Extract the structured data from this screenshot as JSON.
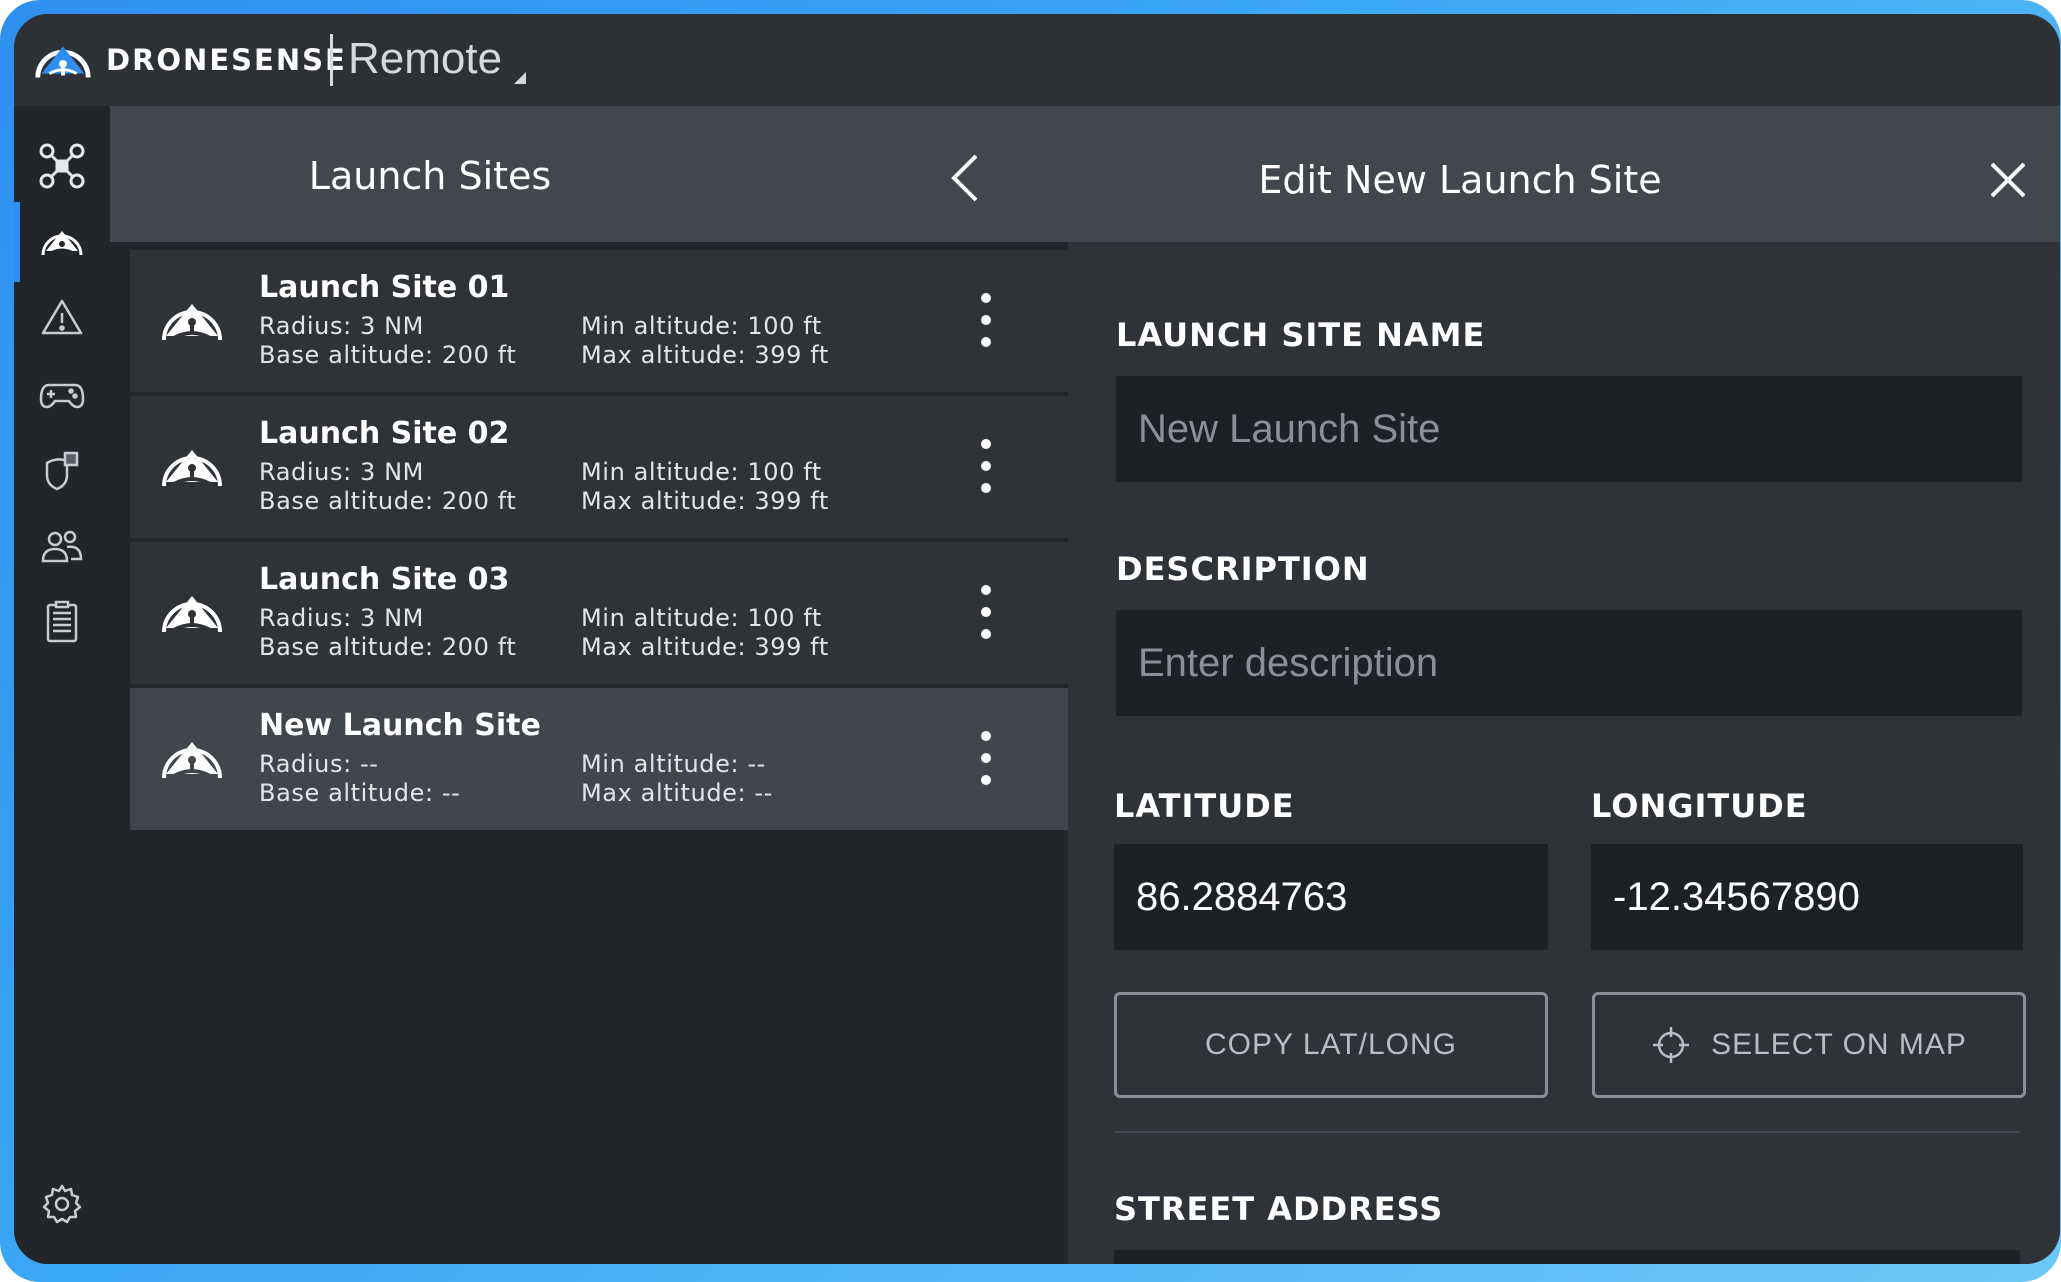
{
  "app": {
    "brand": "DRONESENSE",
    "app_name": "Remote"
  },
  "rail": {
    "items": [
      {
        "icon": "drone-icon",
        "active": false
      },
      {
        "icon": "launch-site-icon",
        "active": true
      },
      {
        "icon": "alert-icon",
        "active": false
      },
      {
        "icon": "gamepad-icon",
        "active": false
      },
      {
        "icon": "shield-badge-icon",
        "active": false
      },
      {
        "icon": "users-icon",
        "active": false
      },
      {
        "icon": "document-icon",
        "active": false
      },
      {
        "icon": "gear-icon",
        "active": false
      }
    ]
  },
  "list": {
    "title": "Launch Sites",
    "sites": [
      {
        "name": "Launch Site 01",
        "radius": "Radius: 3 NM",
        "base": "Base altitude: 200 ft",
        "min": "Min altitude: 100 ft",
        "max": "Max altitude: 399 ft"
      },
      {
        "name": "Launch Site 02",
        "radius": "Radius: 3 NM",
        "base": "Base altitude: 200 ft",
        "min": "Min altitude: 100 ft",
        "max": "Max altitude: 399 ft"
      },
      {
        "name": "Launch Site 03",
        "radius": "Radius: 3 NM",
        "base": "Base altitude: 200 ft",
        "min": "Min altitude: 100 ft",
        "max": "Max altitude: 399 ft"
      },
      {
        "name": "New Launch Site",
        "radius": "Radius: --",
        "base": "Base altitude: --",
        "min": "Min altitude: --",
        "max": "Max altitude: --"
      }
    ]
  },
  "edit": {
    "title": "Edit New Launch Site",
    "name_label": "LAUNCH SITE NAME",
    "name_placeholder": "New Launch Site",
    "description_label": "DESCRIPTION",
    "description_placeholder": "Enter description",
    "latitude_label": "LATITUDE",
    "latitude_value": "86.2884763",
    "longitude_label": "LONGITUDE",
    "longitude_value": "-12.34567890",
    "copy_button": "COPY LAT/LONG",
    "map_button": "SELECT ON MAP",
    "street_label": "STREET ADDRESS"
  },
  "colors": {
    "accent": "#2f8ff0",
    "panel": "#2f3338",
    "header": "#42474e",
    "input_bg": "#1d2024"
  }
}
